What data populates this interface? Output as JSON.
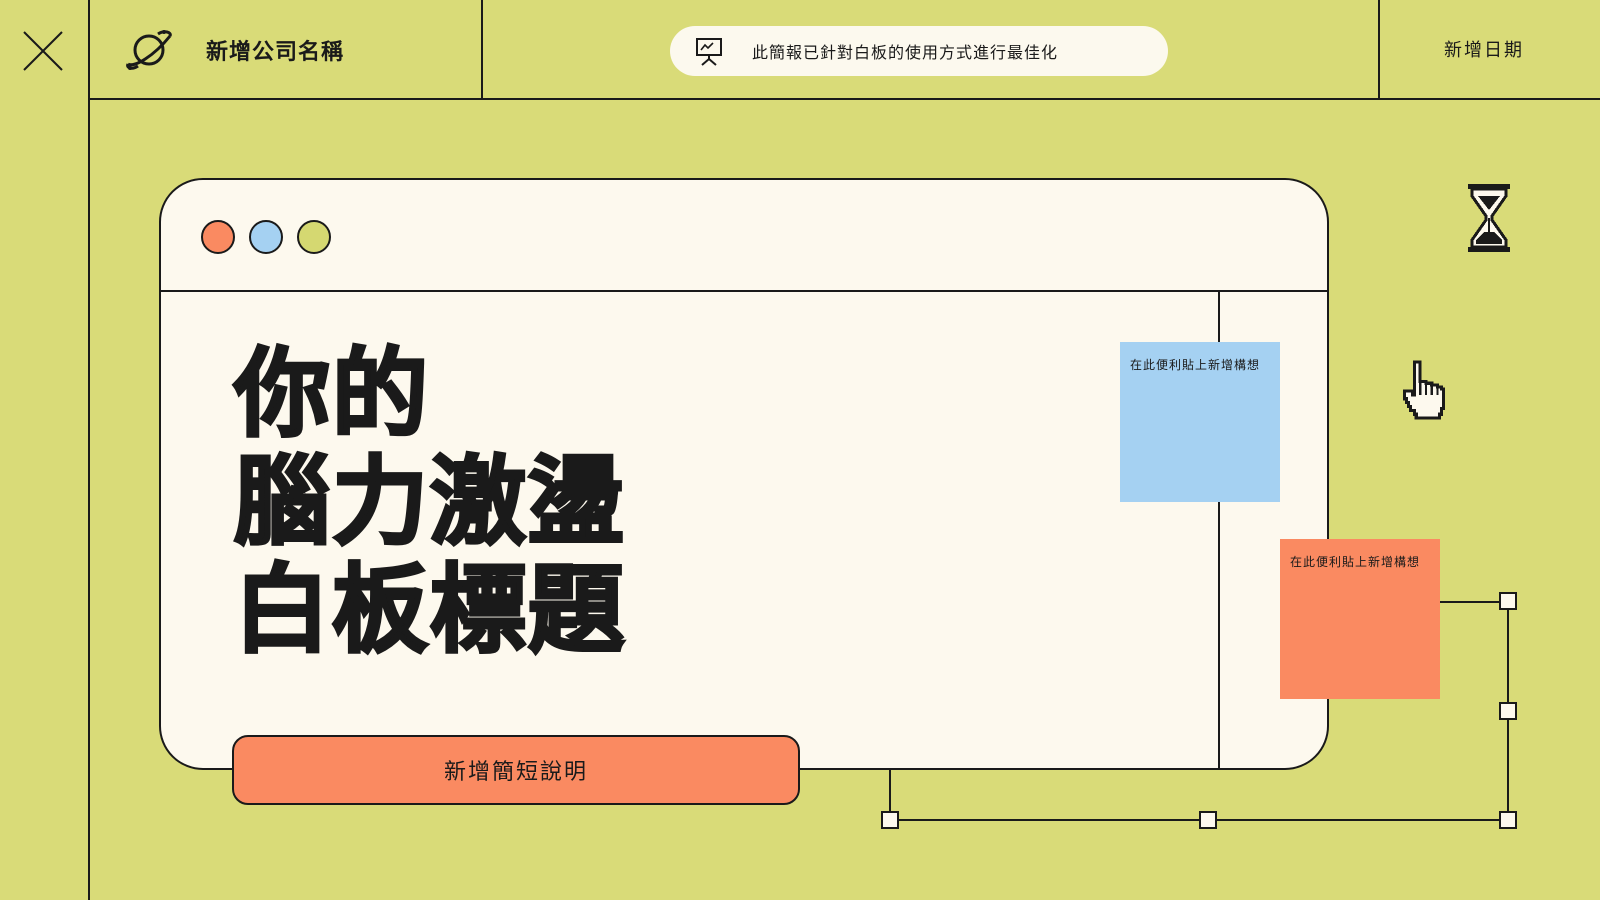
{
  "header": {
    "company_name": "新增公司名稱",
    "notice": "此簡報已針對白板的使用方式進行最佳化",
    "date": "新增日期"
  },
  "main": {
    "title_lines": [
      "你的",
      "腦力激盪",
      "白板標題"
    ],
    "description": "新增簡短說明"
  },
  "sticky_notes": [
    {
      "text": "在此便利貼上新增構想",
      "color": "#a5d1f2"
    },
    {
      "text": "在此便利貼上新增構想",
      "color": "#fa8a61"
    }
  ],
  "window_dots": [
    "#fa8a61",
    "#a5d1f2",
    "#d5d871"
  ],
  "colors": {
    "background": "#d9db78",
    "paper": "#fdf9ee",
    "accent_orange": "#fa8a61",
    "accent_blue": "#a5d1f2",
    "ink": "#1a1a1a"
  },
  "icons": [
    "close-icon",
    "planet-logo-icon",
    "presentation-board-icon",
    "hourglass-icon",
    "pointer-hand-icon"
  ]
}
